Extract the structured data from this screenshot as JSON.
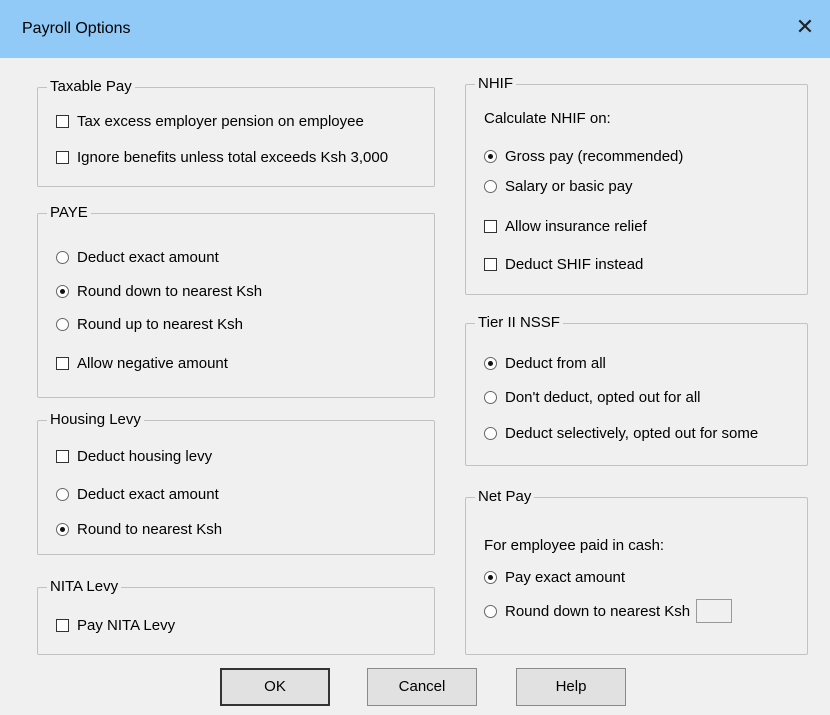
{
  "window": {
    "title": "Payroll Options",
    "close_icon": "close-icon"
  },
  "taxable_pay": {
    "legend": "Taxable Pay",
    "options": [
      {
        "label": "Tax excess employer pension on employee",
        "checked": false
      },
      {
        "label": "Ignore benefits unless total exceeds Ksh 3,000",
        "checked": false
      }
    ]
  },
  "paye": {
    "legend": "PAYE",
    "radios": [
      {
        "label": "Deduct exact amount",
        "selected": false
      },
      {
        "label": "Round down to nearest Ksh",
        "selected": true
      },
      {
        "label": "Round up to nearest Ksh",
        "selected": false
      }
    ],
    "checkbox": {
      "label": "Allow negative amount",
      "checked": false
    }
  },
  "housing_levy": {
    "legend": "Housing Levy",
    "checkbox": {
      "label": "Deduct housing levy",
      "checked": false
    },
    "radios": [
      {
        "label": "Deduct exact amount",
        "selected": false
      },
      {
        "label": "Round to nearest Ksh",
        "selected": true
      }
    ]
  },
  "nita_levy": {
    "legend": "NITA Levy",
    "checkbox": {
      "label": "Pay NITA Levy",
      "checked": false
    }
  },
  "nhif": {
    "legend": "NHIF",
    "prompt": "Calculate NHIF on:",
    "radios": [
      {
        "label": "Gross pay (recommended)",
        "selected": true
      },
      {
        "label": "Salary or basic pay",
        "selected": false
      }
    ],
    "checkboxes": [
      {
        "label": "Allow insurance relief",
        "checked": false
      },
      {
        "label": "Deduct SHIF instead",
        "checked": false
      }
    ]
  },
  "tier2_nssf": {
    "legend": "Tier II NSSF",
    "radios": [
      {
        "label": "Deduct from all",
        "selected": true
      },
      {
        "label": "Don't deduct, opted out for all",
        "selected": false
      },
      {
        "label": "Deduct selectively, opted out for some",
        "selected": false
      }
    ]
  },
  "net_pay": {
    "legend": "Net Pay",
    "prompt": "For employee paid in cash:",
    "radios": [
      {
        "label": "Pay exact amount",
        "selected": true
      },
      {
        "label": "Round down to nearest Ksh",
        "selected": false
      }
    ],
    "amount_value": ""
  },
  "buttons": {
    "ok": "OK",
    "cancel": "Cancel",
    "help": "Help"
  }
}
